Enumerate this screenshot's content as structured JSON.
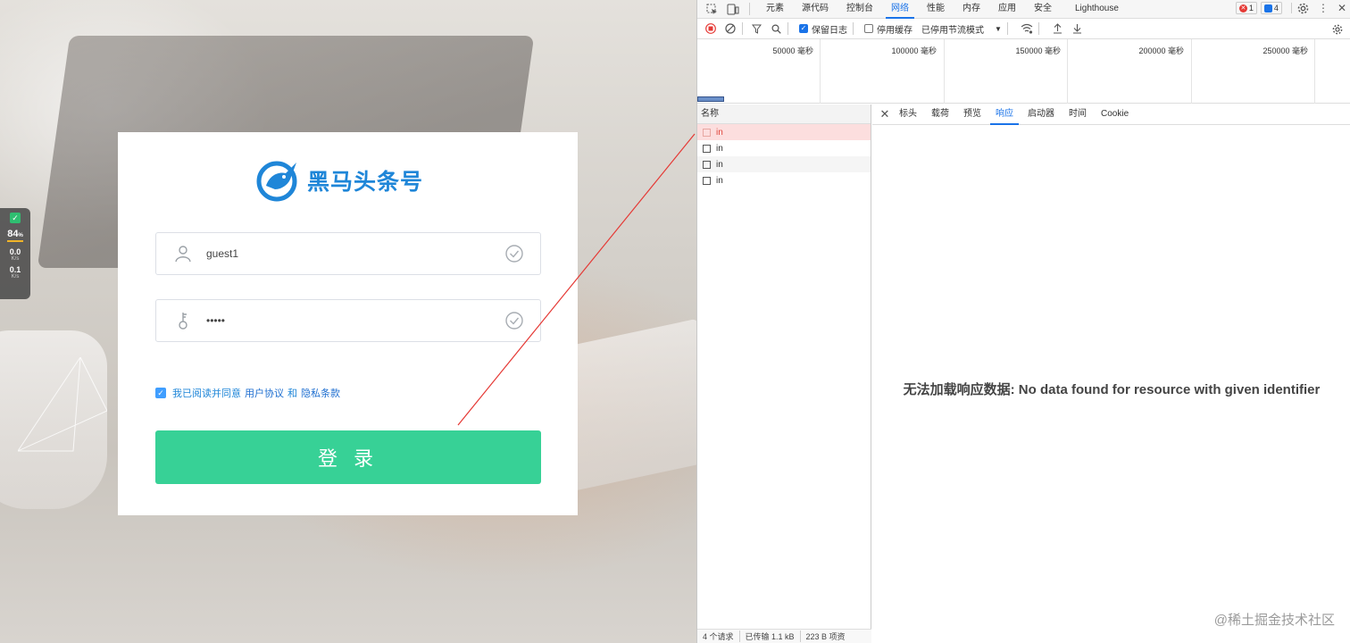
{
  "login": {
    "brand_name": "黑马头条号",
    "username_value": "guest1",
    "password_value": "•••••",
    "agree_text": "我已阅读并同意",
    "agree_link1": "用户协议",
    "agree_and": "和",
    "agree_link2": "隐私条款",
    "login_button": "登 录",
    "brand_color": "#1f86d8",
    "button_color": "#37d196"
  },
  "side_widget": {
    "percent": "84",
    "percent_unit": "%",
    "up_value": "0.0",
    "up_unit": "K/s",
    "down_value": "0.1",
    "down_unit": "K/s"
  },
  "devtools": {
    "tabs": [
      "元素",
      "源代码",
      "控制台",
      "网络",
      "性能",
      "内存",
      "应用",
      "安全",
      "Lighthouse"
    ],
    "active_tab": "网络",
    "error_count": "1",
    "message_count": "4",
    "toolbar": {
      "preserve_log": "保留日志",
      "disable_cache": "停用缓存",
      "throttling": "已停用节流模式"
    },
    "timeline_labels": [
      "50000 毫秒",
      "100000 毫秒",
      "150000 毫秒",
      "200000 毫秒",
      "250000 毫秒"
    ],
    "list_header": "名称",
    "requests": [
      "in",
      "in",
      "in",
      "in"
    ],
    "detail_tabs": [
      "标头",
      "载荷",
      "预览",
      "响应",
      "启动器",
      "时间",
      "Cookie"
    ],
    "active_detail_tab": "响应",
    "no_data_message": "无法加载响应数据: No data found for resource with given identifier",
    "status": {
      "requests": "4 个请求",
      "transferred": "已传输 1.1 kB",
      "resources": "223 B 项资"
    },
    "watermark": "@稀土掘金技术社区",
    "accent_color": "#1a73e8"
  }
}
